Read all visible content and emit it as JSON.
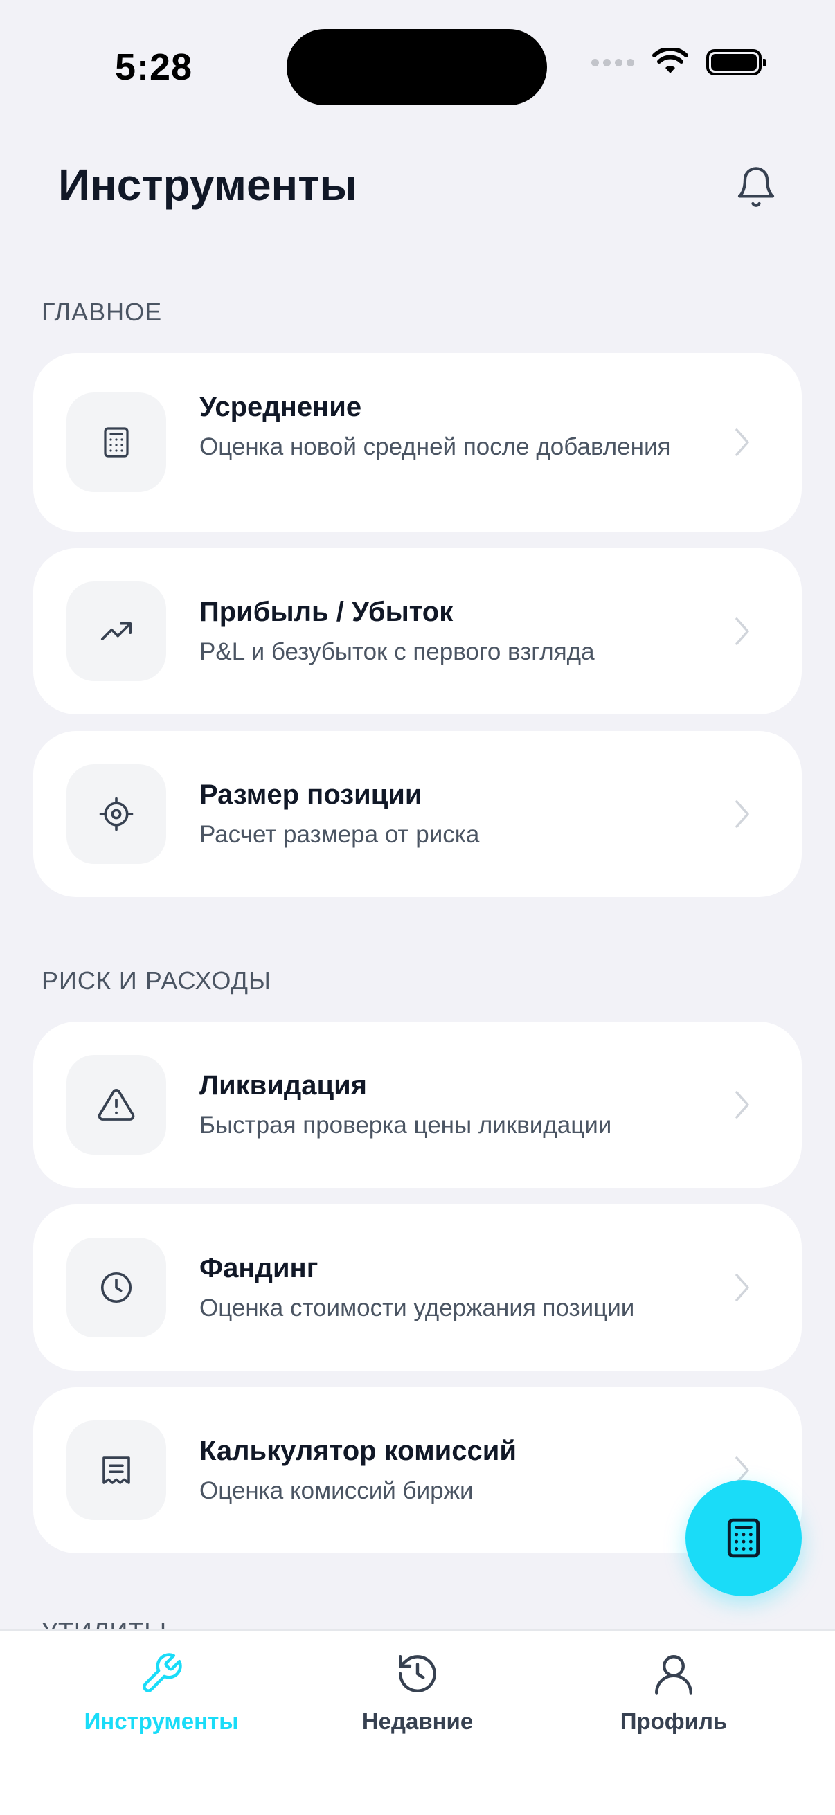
{
  "status_bar": {
    "time": "5:28"
  },
  "header": {
    "title": "Инструменты"
  },
  "sections": [
    {
      "label": "ГЛАВНОЕ",
      "items": [
        {
          "title": "Усреднение",
          "description": "Оценка новой средней после добавления",
          "icon": "calculator-icon"
        },
        {
          "title": "Прибыль / Убыток",
          "description": "P&L и безубыток с первого взгляда",
          "icon": "trending-up-icon"
        },
        {
          "title": "Размер позиции",
          "description": "Расчет размера от риска",
          "icon": "target-icon"
        }
      ]
    },
    {
      "label": "РИСК И РАСХОДЫ",
      "items": [
        {
          "title": "Ликвидация",
          "description": "Быстрая проверка цены ликвидации",
          "icon": "warning-triangle-icon"
        },
        {
          "title": "Фандинг",
          "description": "Оценка стоимости удержания позиции",
          "icon": "clock-icon"
        },
        {
          "title": "Калькулятор комиссий",
          "description": "Оценка комиссий биржи",
          "icon": "receipt-icon"
        }
      ]
    }
  ],
  "partial_section_label": "УТИЛИТЫ",
  "fab": {
    "icon": "calculator-icon"
  },
  "tabs": [
    {
      "label": "Инструменты",
      "icon": "wrench-icon",
      "active": true
    },
    {
      "label": "Недавние",
      "icon": "history-icon",
      "active": false
    },
    {
      "label": "Профиль",
      "icon": "user-icon",
      "active": false
    }
  ],
  "colors": {
    "accent": "#1ADCF8",
    "background": "#F2F2F7",
    "card": "#FFFFFF",
    "text_primary": "#111827",
    "text_secondary": "#4B5563",
    "tab_inactive": "#374151"
  }
}
